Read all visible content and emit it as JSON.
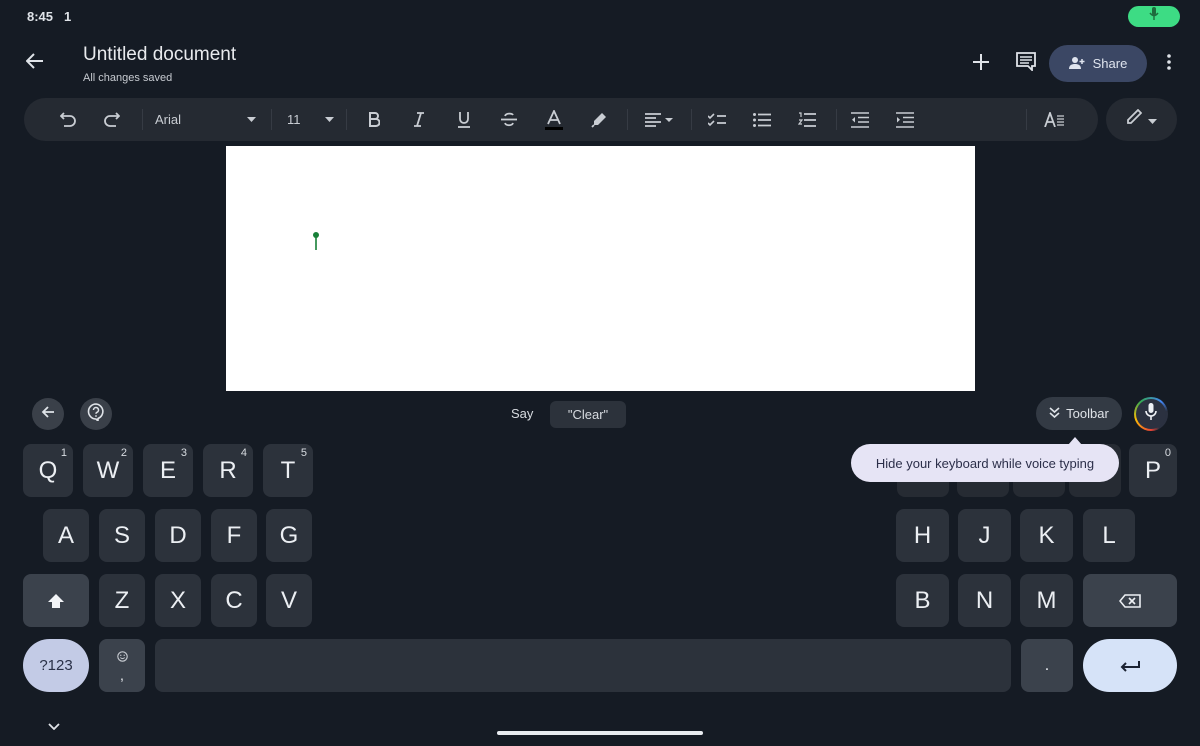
{
  "status_bar": {
    "time": "8:45",
    "notification": "1",
    "mic_indicator_icon": "mic-icon",
    "mic_indicator_color": "#3ddc84"
  },
  "header": {
    "back_icon": "arrow-back-icon",
    "title": "Untitled document",
    "save_status": "All changes saved",
    "add_icon": "plus-icon",
    "comment_icon": "comment-icon",
    "share_label": "Share",
    "share_icon": "person-add-icon",
    "more_icon": "more-vert-icon"
  },
  "toolbar": {
    "undo_icon": "undo-icon",
    "redo_icon": "redo-icon",
    "font_family": "Arial",
    "font_size": "11",
    "bold_icon": "bold-icon",
    "italic_icon": "italic-icon",
    "underline_icon": "underline-icon",
    "strikethrough_icon": "strikethrough-icon",
    "text_color_icon": "text-color-icon",
    "highlight_icon": "highlight-icon",
    "align_icon": "align-left-icon",
    "checklist_icon": "checklist-icon",
    "bullet_list_icon": "bulleted-list-icon",
    "numbered_list_icon": "numbered-list-icon",
    "decrease_indent_icon": "decrease-indent-icon",
    "increase_indent_icon": "increase-indent-icon",
    "text_format_icon": "text-format-icon",
    "edit_mode_icon": "pencil-icon"
  },
  "document": {
    "cursor_color": "#188038"
  },
  "suggestion_strip": {
    "say_label": "Say",
    "suggestion_chip": "\"Clear\"",
    "toolbar_chip_label": "Toolbar",
    "tooltip": "Hide your keyboard while voice typing"
  },
  "keyboard": {
    "row1": [
      {
        "key": "Q",
        "hint": "1"
      },
      {
        "key": "W",
        "hint": "2"
      },
      {
        "key": "E",
        "hint": "3"
      },
      {
        "key": "R",
        "hint": "4"
      },
      {
        "key": "T",
        "hint": "5"
      },
      {
        "key": "P",
        "hint": "0"
      }
    ],
    "row2_left": [
      "A",
      "S",
      "D",
      "F",
      "G"
    ],
    "row2_right": [
      "H",
      "J",
      "K",
      "L"
    ],
    "row3_left": [
      "Z",
      "X",
      "C",
      "V"
    ],
    "row3_right": [
      "B",
      "N",
      "M"
    ],
    "symbols_label": "?123",
    "emoji_comma_label": ",",
    "period_label": ".",
    "enter_icon": "enter-icon",
    "backspace_icon": "backspace-icon",
    "shift_icon": "shift-icon",
    "accent_color": "#c3cbe6"
  }
}
